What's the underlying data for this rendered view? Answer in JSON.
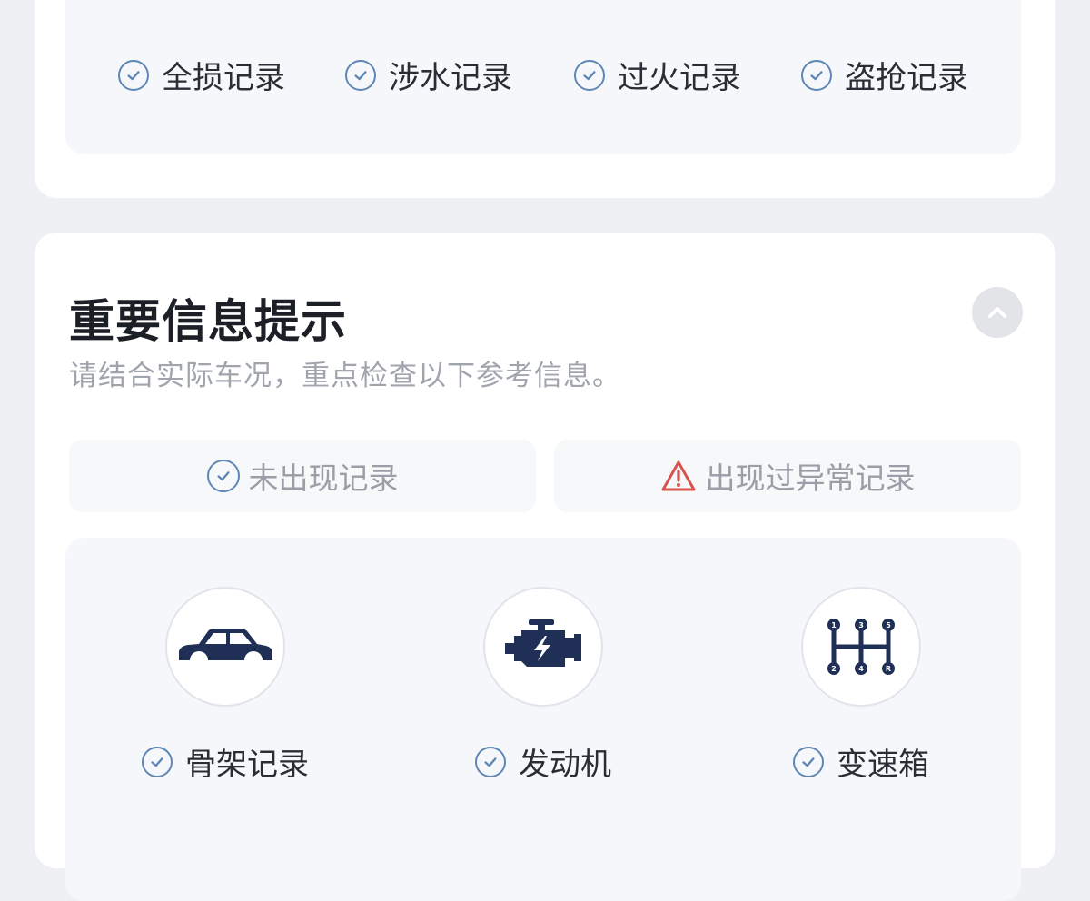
{
  "top_records": {
    "items": [
      {
        "label": "全损记录",
        "status": "ok"
      },
      {
        "label": "涉水记录",
        "status": "ok"
      },
      {
        "label": "过火记录",
        "status": "ok"
      },
      {
        "label": "盗抢记录",
        "status": "ok"
      }
    ]
  },
  "important_info": {
    "title": "重要信息提示",
    "subtitle": "请结合实际车况，重点检查以下参考信息。",
    "collapse_icon": "chevron-up-icon",
    "legend": {
      "ok_label": "未出现记录",
      "warn_label": "出现过异常记录"
    },
    "parts": [
      {
        "label": "骨架记录",
        "icon": "car-body-icon",
        "status": "ok"
      },
      {
        "label": "发动机",
        "icon": "engine-icon",
        "status": "ok"
      },
      {
        "label": "变速箱",
        "icon": "gearbox-icon",
        "status": "ok"
      }
    ]
  },
  "colors": {
    "ok_check": "#5f86b5",
    "warn": "#d9534f",
    "icon_fill": "#1f2f55"
  }
}
